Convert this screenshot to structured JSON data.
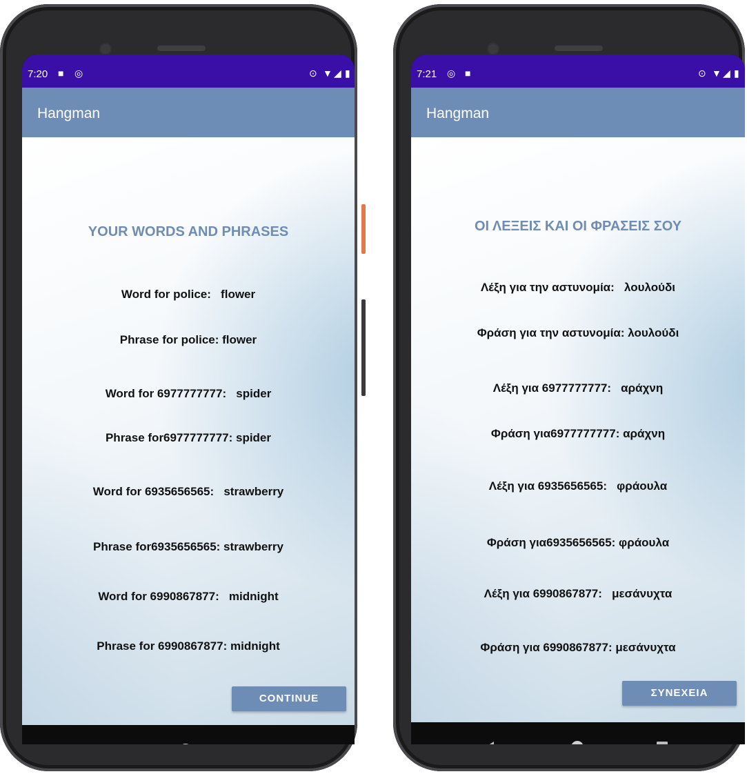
{
  "left_phone": {
    "status": {
      "time": "7:20",
      "left_icons": [
        "sd-card-icon",
        "sync-icon"
      ],
      "right_icons": [
        "location-icon",
        "wifi-icon",
        "signal-icon",
        "battery-icon"
      ]
    },
    "app_title": "Hangman",
    "heading": "YOUR WORDS AND PHRASES",
    "entries": [
      "Word for police:   flower",
      "Phrase for police: flower",
      "Word for 6977777777:   spider",
      "Phrase for6977777777: spider",
      "Word for 6935656565:   strawberry",
      "Phrase for6935656565: strawberry",
      "Word for 6990867877:   midnight",
      "Phrase for 6990867877: midnight"
    ],
    "button_label": "CONTINUE"
  },
  "right_phone": {
    "status": {
      "time": "7:21",
      "left_icons": [
        "sync-icon",
        "sd-card-icon"
      ],
      "right_icons": [
        "location-icon",
        "wifi-icon",
        "signal-icon",
        "battery-icon"
      ]
    },
    "app_title": "Hangman",
    "heading": "ΟΙ ΛΕΞΕΙΣ ΚΑΙ ΟΙ ΦΡΑΣΕΙΣ ΣΟΥ",
    "entries": [
      "Λέξη για την αστυνομία:   λουλούδι",
      "Φράση για την αστυνομία: λουλούδι",
      "Λέξη για 6977777777:   αράχνη",
      "Φράση για6977777777: αράχνη",
      "Λέξη για 6935656565:   φράουλα",
      "Φράση για6935656565: φράουλα",
      "Λέξη για 6990867877:   μεσάνυχτα",
      "Φράση για 6990867877: μεσάνυχτα"
    ],
    "button_label": "ΣΥΝΕΧΕΙΑ"
  },
  "colors": {
    "status_bar": "#3a0fa8",
    "app_bar": "#6e8db6",
    "heading_text": "#6f8cb5"
  }
}
